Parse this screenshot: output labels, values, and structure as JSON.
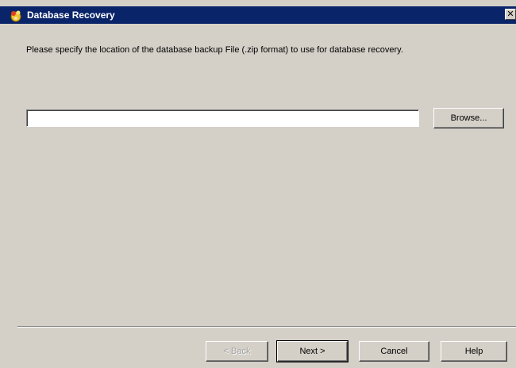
{
  "window": {
    "title": "Database Recovery",
    "icon": "wizard-app-icon",
    "close_glyph": "✕"
  },
  "content": {
    "instructions": "Please specify the location of the database backup File (.zip format) to use for database recovery.",
    "path_value": "",
    "browse_label": "Browse..."
  },
  "footer": {
    "back_label": "< Back",
    "next_label": "Next >",
    "cancel_label": "Cancel",
    "help_label": "Help"
  },
  "colors": {
    "titlebar": "#0a246a",
    "dialog_bg": "#d4d0c8"
  }
}
